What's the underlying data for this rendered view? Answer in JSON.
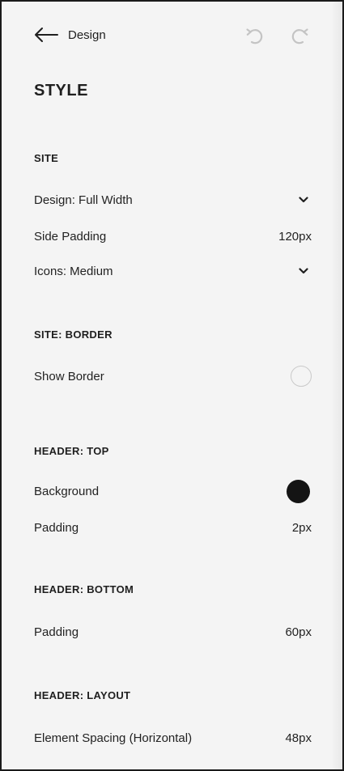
{
  "header": {
    "back_label": "Design",
    "back_icon": "arrow-left-icon",
    "undo_icon": "undo-icon",
    "redo_icon": "redo-icon"
  },
  "page_title": "STYLE",
  "sections": {
    "site": {
      "title": "SITE",
      "design": {
        "label": "Design: Full Width"
      },
      "side_padding": {
        "label": "Side Padding",
        "value": "120px"
      },
      "icons": {
        "label": "Icons: Medium"
      }
    },
    "site_border": {
      "title": "SITE: BORDER",
      "show_border": {
        "label": "Show Border",
        "enabled": false
      }
    },
    "header_top": {
      "title": "HEADER: TOP",
      "background": {
        "label": "Background",
        "color": "#141414"
      },
      "padding": {
        "label": "Padding",
        "value": "2px"
      }
    },
    "header_bottom": {
      "title": "HEADER: BOTTOM",
      "padding": {
        "label": "Padding",
        "value": "60px"
      }
    },
    "header_layout": {
      "title": "HEADER: LAYOUT",
      "element_spacing": {
        "label": "Element Spacing (Horizontal)",
        "value": "48px"
      }
    }
  },
  "colors": {
    "panel_bg": "#f4f4f4",
    "text": "#1f1f1f",
    "icon_muted": "#c4c4c4",
    "swatch": "#141414"
  }
}
